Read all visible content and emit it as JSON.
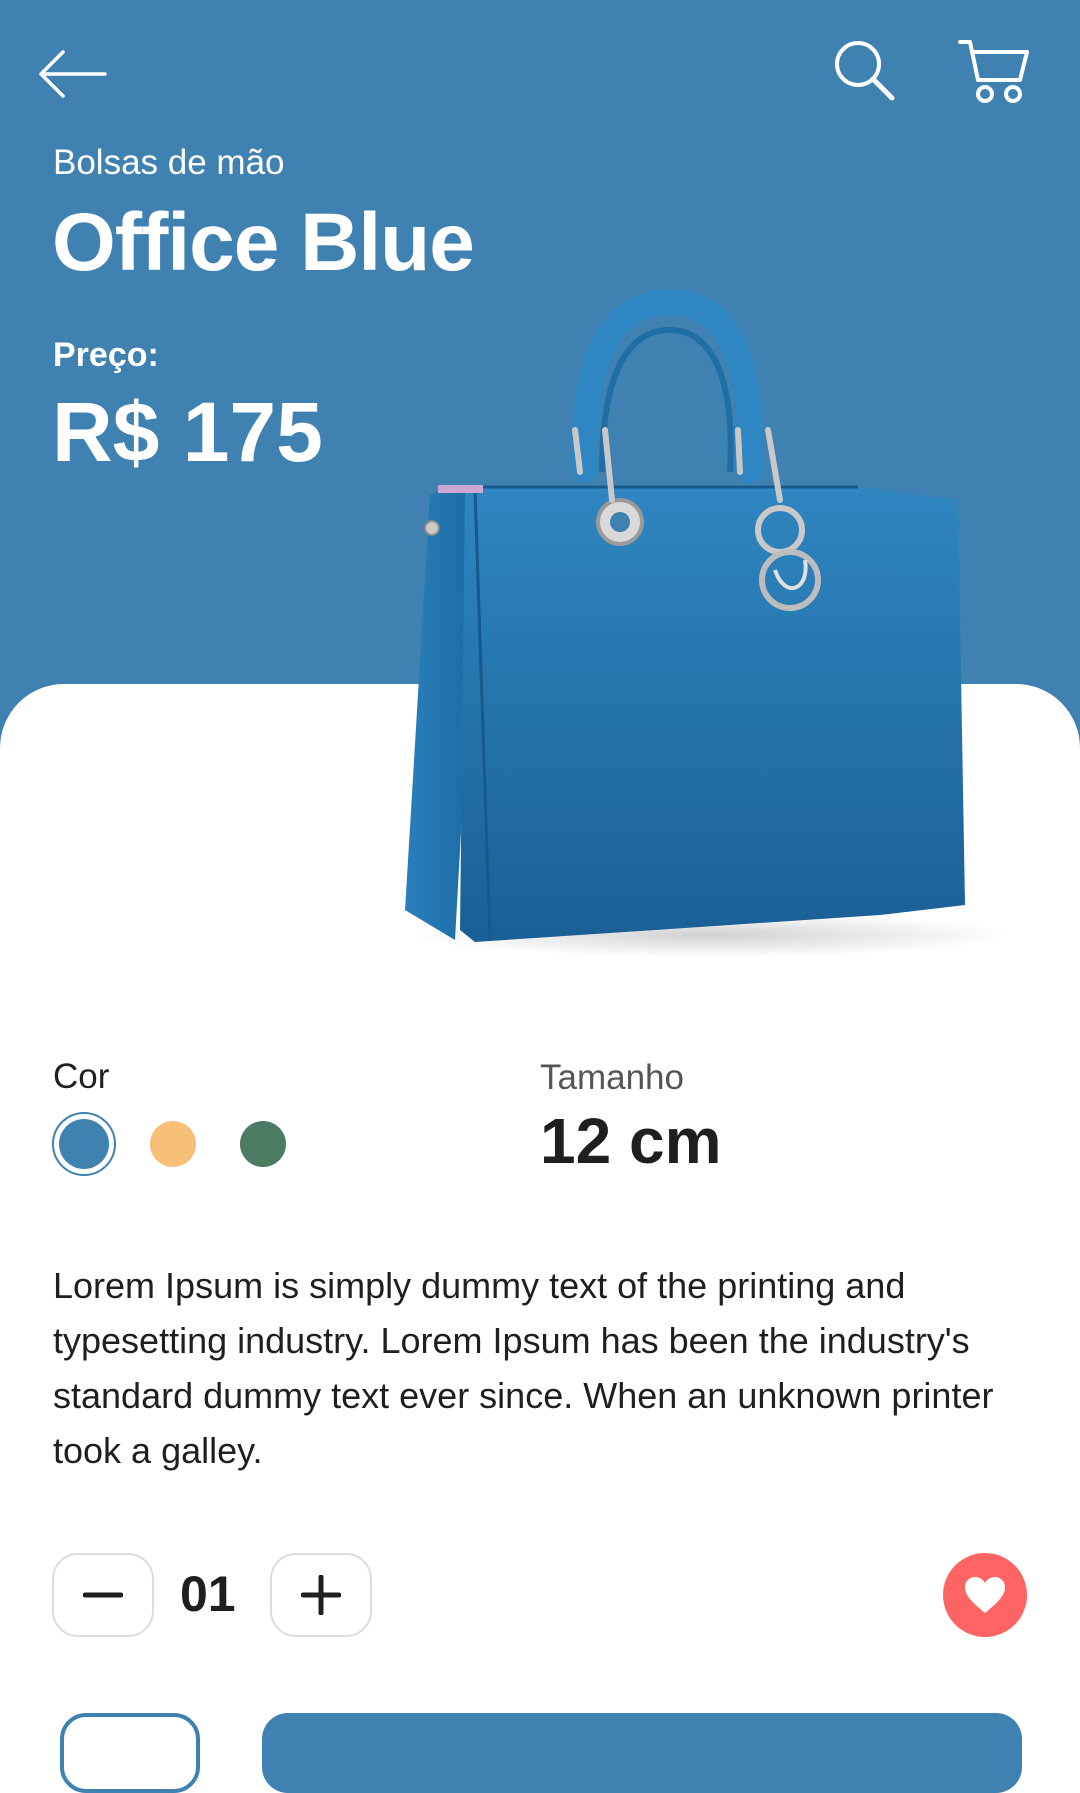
{
  "colors": {
    "accent": "#3f81b1",
    "favorite": "#ff6464"
  },
  "header": {
    "back_icon": "arrow-left-icon",
    "search_icon": "search-icon",
    "cart_icon": "shopping-cart-icon"
  },
  "product": {
    "category": "Bolsas de mão",
    "title": "Office Blue",
    "price_label": "Preço:",
    "price": "R$ 175"
  },
  "options": {
    "color_label": "Cor",
    "colors": [
      "#3f81b1",
      "#f7bf77",
      "#4b7b61"
    ],
    "selected_color": 0,
    "size_label": "Tamanho",
    "size_value": "12 cm"
  },
  "description": "Lorem Ipsum is simply dummy text of the printing and typesetting industry. Lorem Ipsum has been the industry's standard dummy text ever since. When an unknown printer took a galley.",
  "quantity": {
    "value": "01",
    "decrement_icon": "minus-icon",
    "increment_icon": "plus-icon"
  },
  "favorite_icon": "heart-icon"
}
